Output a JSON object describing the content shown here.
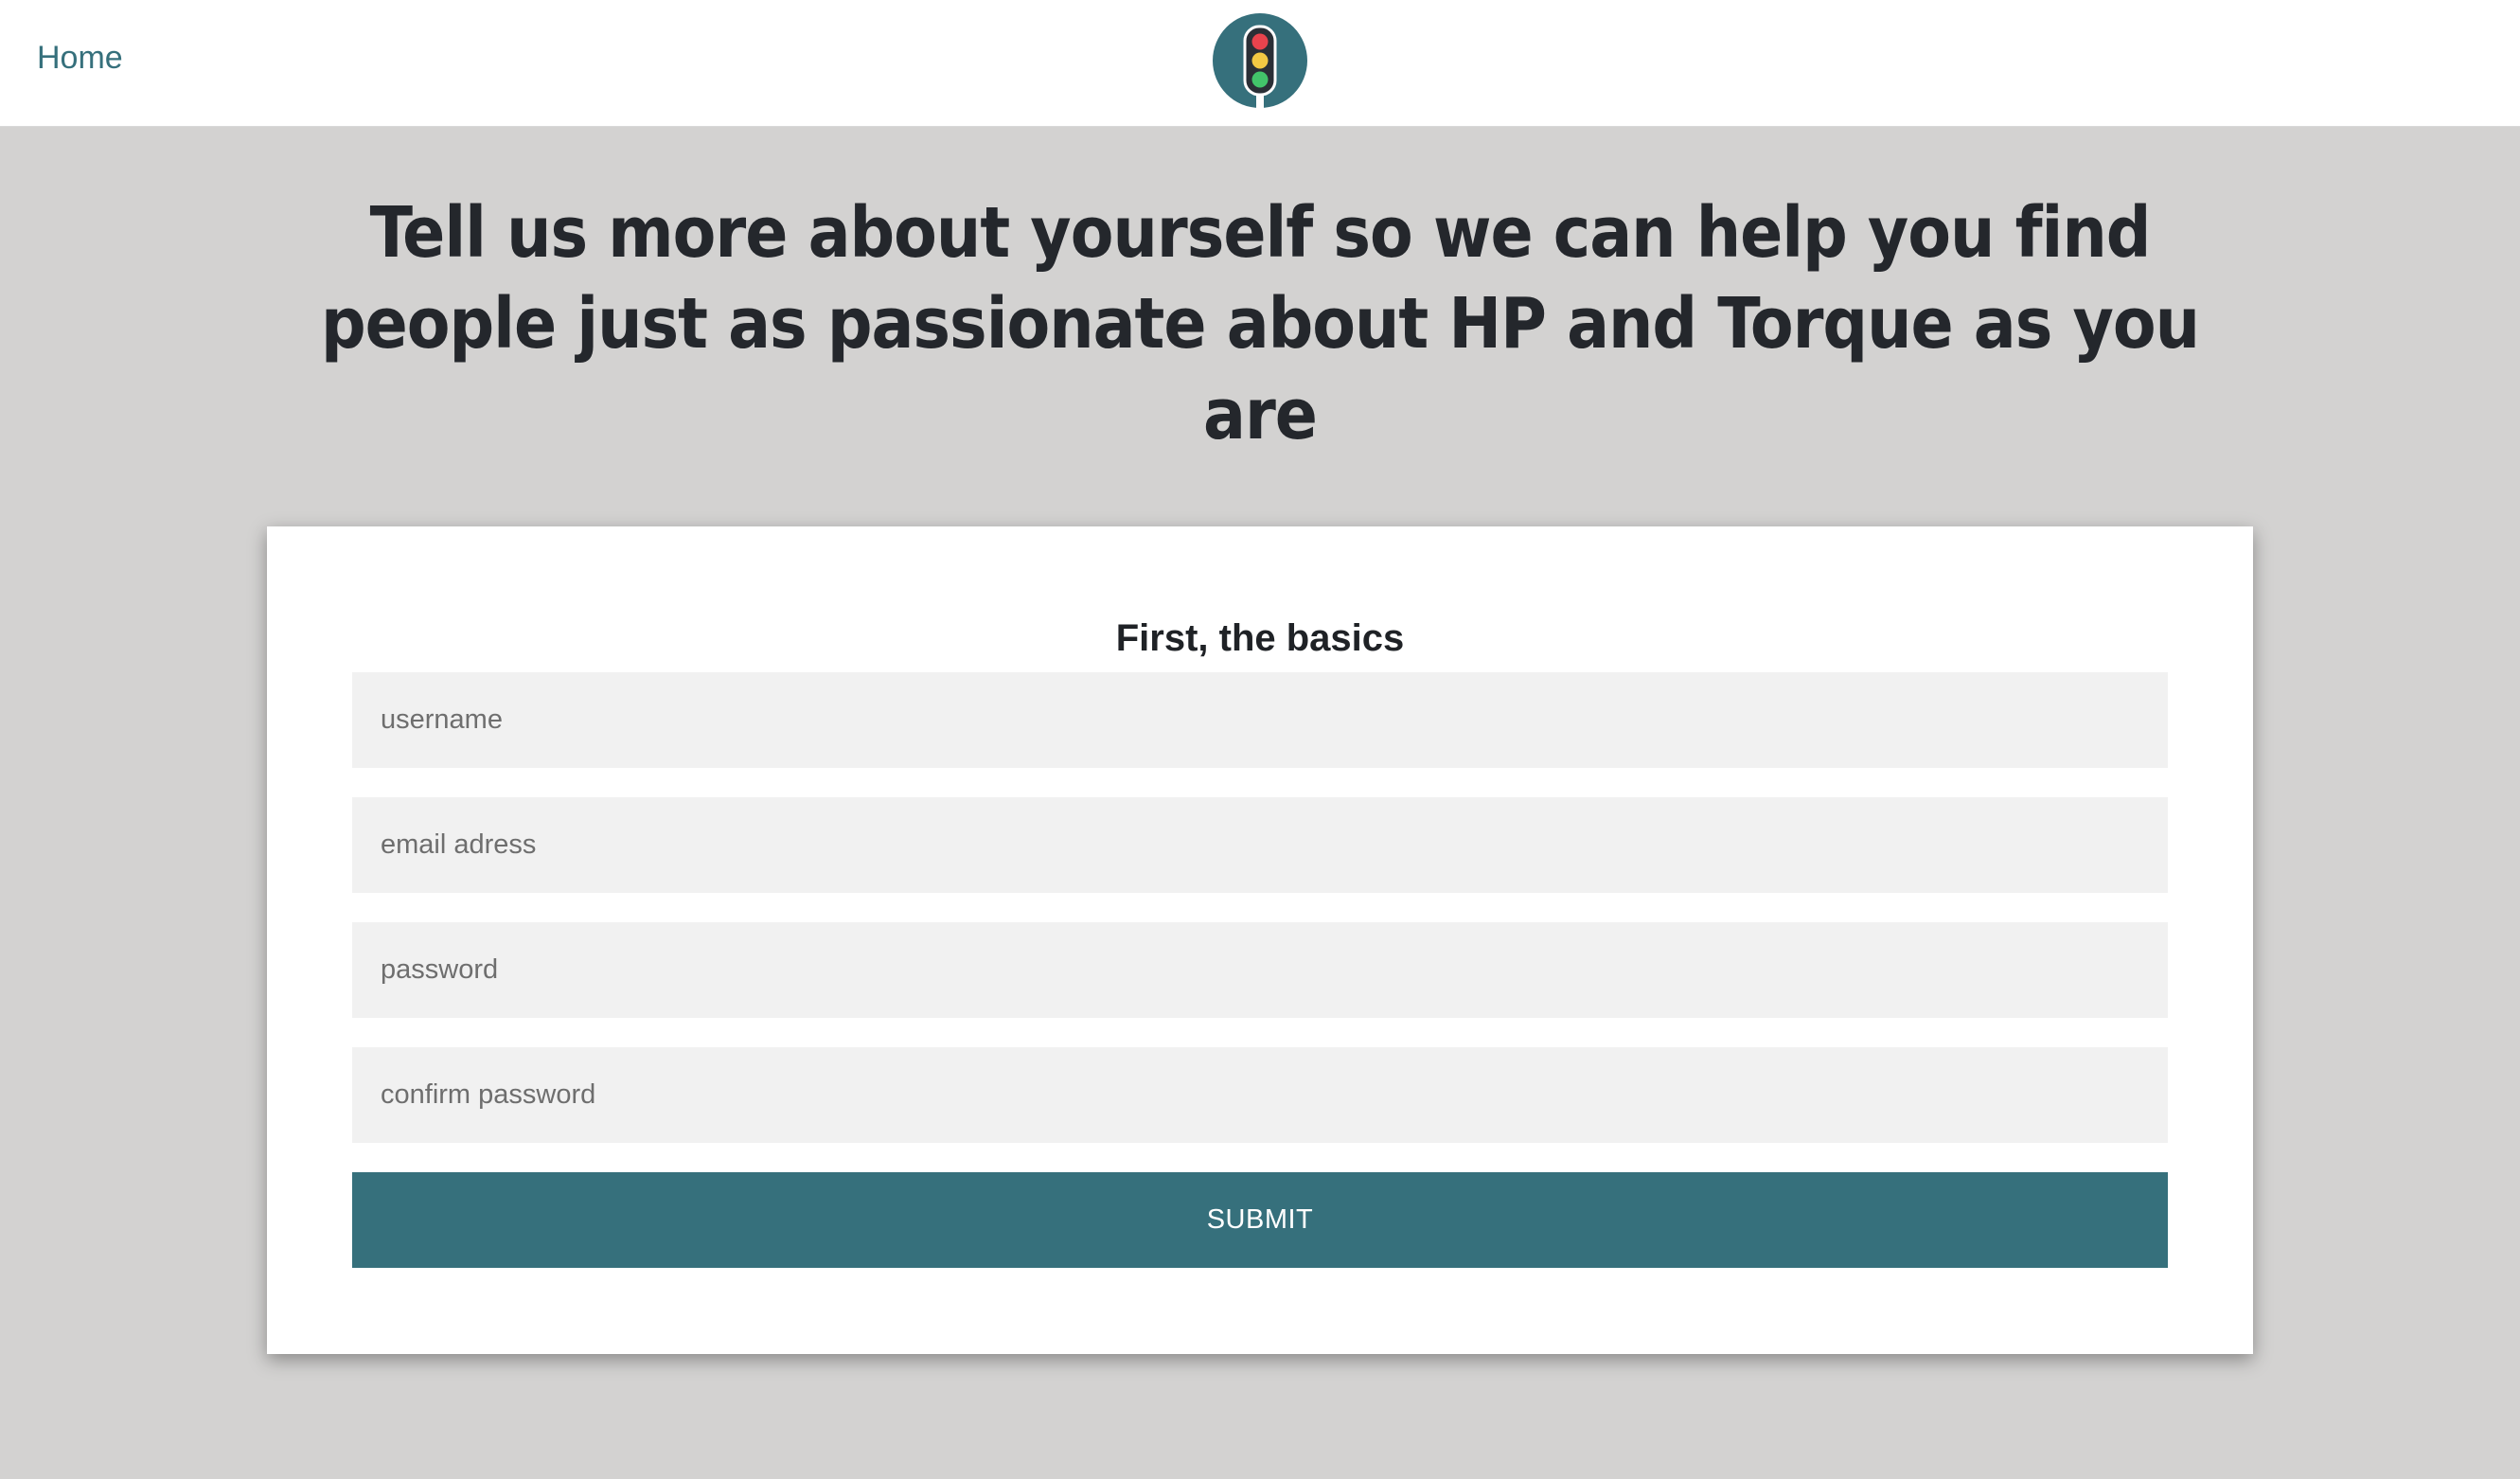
{
  "nav": {
    "home_label": "Home",
    "logo_icon": "traffic-light-icon"
  },
  "hero": {
    "headline": "Tell us more about yourself so we can help you find people just as passionate about HP and Torque as you are"
  },
  "form": {
    "title": "First, the basics",
    "fields": [
      {
        "placeholder": "username",
        "value": ""
      },
      {
        "placeholder": "email adress",
        "value": ""
      },
      {
        "placeholder": "password",
        "value": ""
      },
      {
        "placeholder": "confirm password",
        "value": ""
      }
    ],
    "submit_label": "SUBMIT"
  },
  "colors": {
    "accent": "#36707c",
    "page_background": "#d3d2d1",
    "card_background": "#ffffff",
    "field_background": "#f1f1f1",
    "light_red": "#e8434d",
    "light_yellow": "#f3c843",
    "light_green": "#42c46a"
  }
}
